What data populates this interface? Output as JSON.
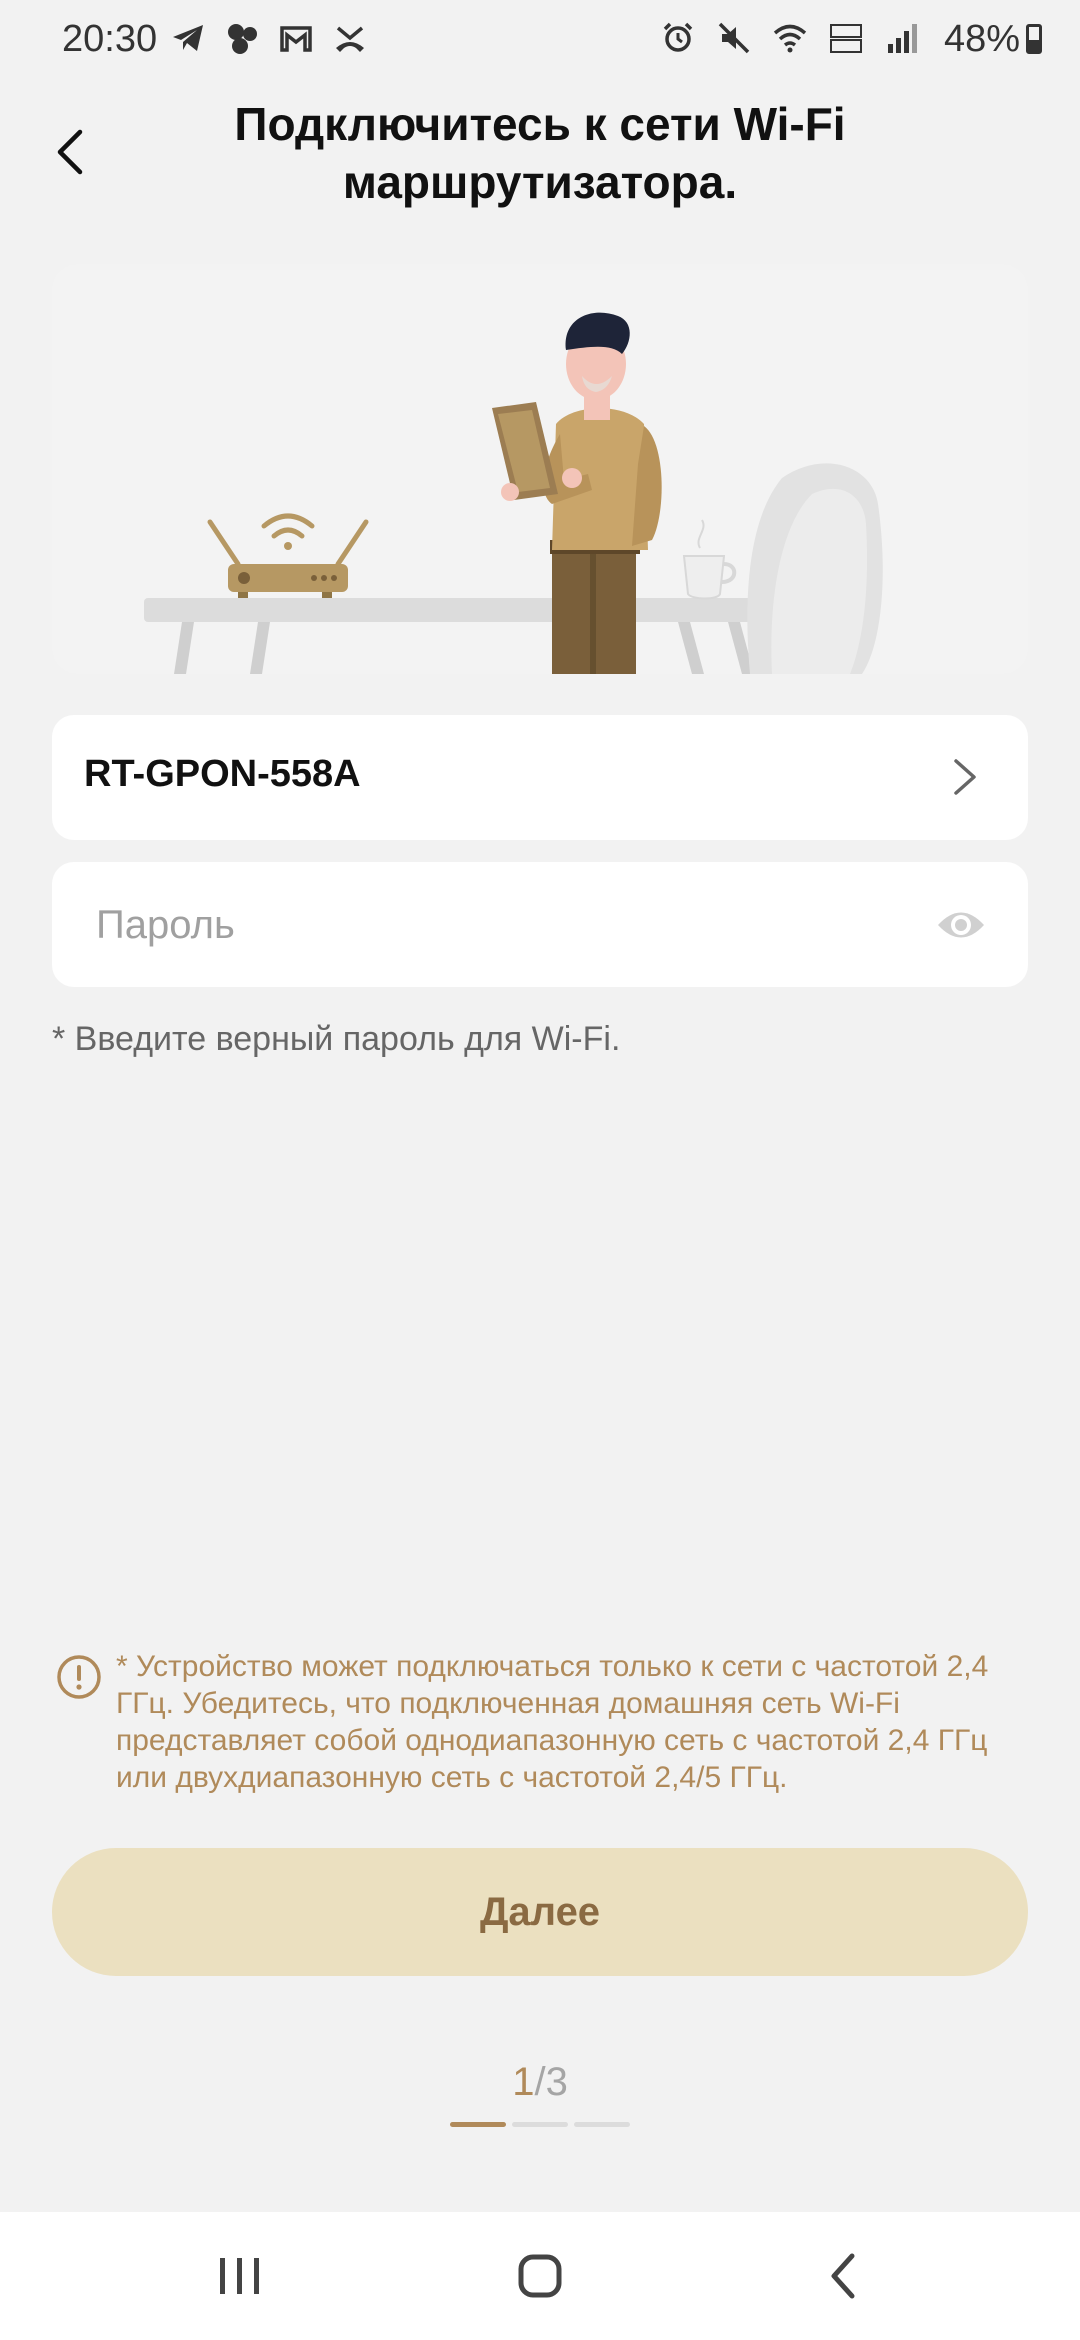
{
  "status_bar": {
    "time": "20:30",
    "battery": "48%",
    "left_icons": [
      "telegram-icon",
      "app-cluster-icon",
      "gmail-icon",
      "missed-call-icon"
    ],
    "right_icons": [
      "alarm-icon",
      "mute-icon",
      "wifi-icon",
      "volte-icon",
      "signal-icon",
      "battery-icon"
    ]
  },
  "header": {
    "title": "Подключитесь к сети Wi-Fi маршрутизатора."
  },
  "network": {
    "ssid": "RT-GPON-558A"
  },
  "password": {
    "placeholder": "Пароль",
    "value": ""
  },
  "hint": "* Введите верный пароль для Wi-Fi.",
  "warning": {
    "text": "* Устройство может подключаться только к сети с частотой 2,4 ГГц. Убедитесь, что подключенная домашняя сеть Wi-Fi представляет собой однодиапазонную сеть с частотой 2,4 ГГц или двухдиапазонную сеть с частотой 2,4/5 ГГц."
  },
  "next_button": {
    "label": "Далее"
  },
  "pager": {
    "current": "1",
    "separator": "/",
    "total": "3",
    "progress": 0.333
  },
  "colors": {
    "accent": "#b08a5a",
    "button_bg": "#ebe0c0",
    "button_text": "#8a6a42",
    "background": "#f2f2f2"
  }
}
